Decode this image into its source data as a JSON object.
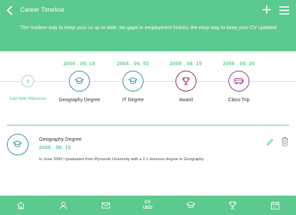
{
  "header": {
    "title": "Career Timeline",
    "tagline": "The modern way to keep your cv up to date. No gaps in employment history, the easy way to keep your CV updated",
    "back_icon": "chevron-left-icon",
    "add_icon": "plus-icon",
    "menu_icon": "hamburger-menu-icon"
  },
  "timeline": {
    "add_label": "Add New Milestone",
    "milestones": [
      {
        "date": "2000 . 06. 15",
        "label": "Geography Degree",
        "icon": "graduation-cap-icon",
        "color": "#2e8fa0"
      },
      {
        "date": "2004 . 06. 02",
        "label": "IT Degree",
        "icon": "graduation-cap-icon",
        "color": "#2e8fa0"
      },
      {
        "date": "2005 . 06. 15",
        "label": "Award",
        "icon": "trophy-icon",
        "color": "#a01c3c"
      },
      {
        "date": "2008 . 08. 20",
        "label": "Class Trip",
        "icon": "bus-icon",
        "color": "#9c2d8a"
      }
    ]
  },
  "detail": {
    "title": "Geography Degree",
    "date": "2000 . 06. 15",
    "description": "In June 2000 I graduated from Plymouth University with a 2.1 Honours degree in Geography.",
    "icon": "graduation-cap-icon"
  },
  "bottom_nav": {
    "items": [
      "home-icon",
      "user-icon",
      "mail-icon",
      "cv-ued-logo",
      "graduation-cap-icon",
      "trophy-icon",
      "calendar-icon"
    ],
    "cv_line1": "CV",
    "cv_line2": "UED"
  },
  "colors": {
    "brand": "#5cc98f",
    "education": "#2e8fa0",
    "award": "#a01c3c",
    "trip": "#9c2d8a"
  }
}
